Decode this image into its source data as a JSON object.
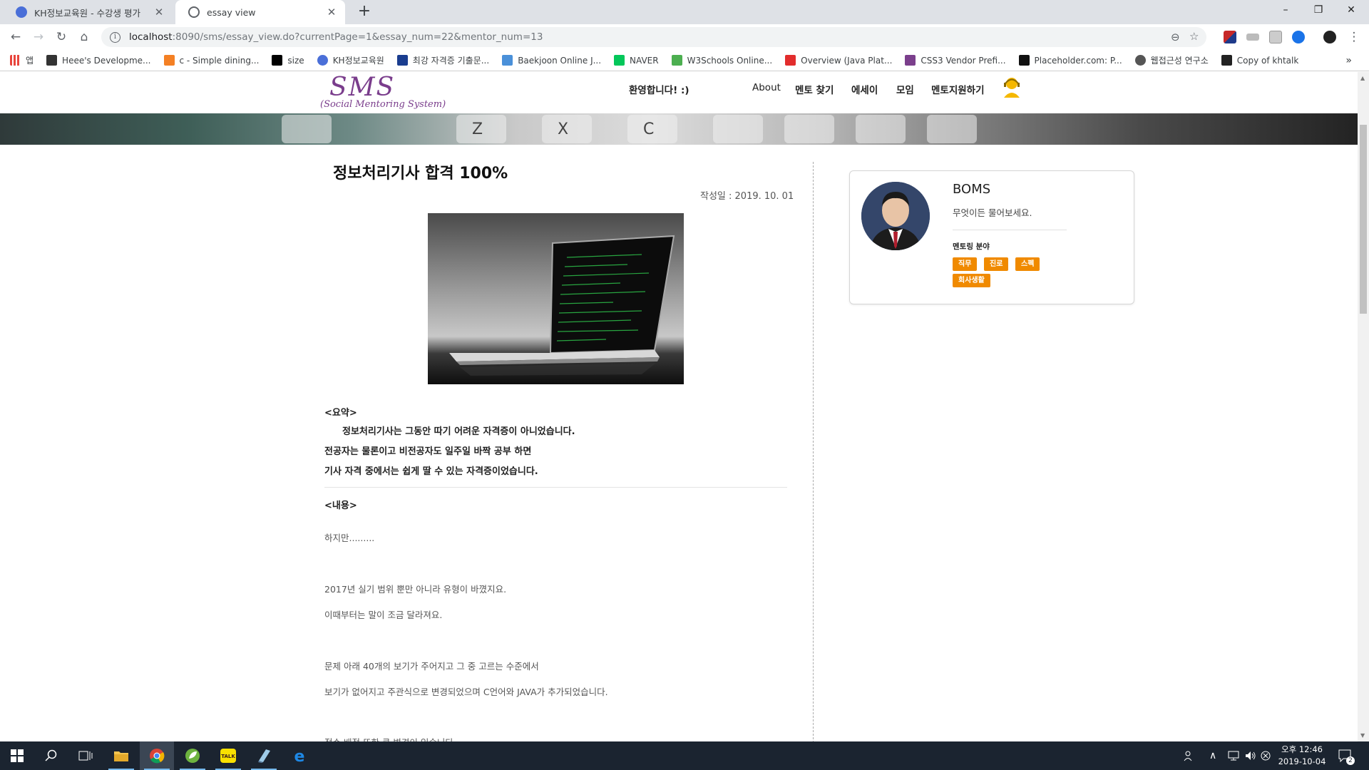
{
  "browser": {
    "tabs": [
      {
        "title": "KH정보교육원 - 수강생 평가",
        "favicon_color": "#4a6fd8"
      },
      {
        "title": "essay view",
        "favicon_color": "#5f6368"
      }
    ],
    "url_host": "localhost",
    "url_path": ":8090/sms/essay_view.do?currentPage=1&essay_num=22&mentor_num=13",
    "bookmarks": [
      {
        "label": "앱",
        "color": "#e8453c"
      },
      {
        "label": "Heee's Developme...",
        "color": "#333333"
      },
      {
        "label": "c - Simple dining...",
        "color": "#f48024"
      },
      {
        "label": "size",
        "color": "#000000"
      },
      {
        "label": "KH정보교육원",
        "color": "#4a6fd8"
      },
      {
        "label": "최강 자격증 기출문...",
        "color": "#1a3d8f"
      },
      {
        "label": "Baekjoon Online J...",
        "color": "#4a90d9"
      },
      {
        "label": "NAVER",
        "color": "#03c75a"
      },
      {
        "label": "W3Schools Online...",
        "color": "#4caf50"
      },
      {
        "label": "Overview (Java Plat...",
        "color": "#e22d2d"
      },
      {
        "label": "CSS3 Vendor Prefi...",
        "color": "#7b3f8c"
      },
      {
        "label": "Placeholder.com: P...",
        "color": "#111111"
      },
      {
        "label": "웹접근성 연구소",
        "color": "#555555"
      },
      {
        "label": "Copy of khtalk",
        "color": "#222222"
      }
    ]
  },
  "site": {
    "logo": "SMS",
    "logo_sub": "(Social Mentoring System)",
    "welcome": "환영합니다! :)",
    "nav": [
      "About",
      "멘토 찾기",
      "에세이",
      "모임",
      "멘토지원하기"
    ]
  },
  "article": {
    "title": "정보처리기사 합격 100%",
    "date": "작성일 : 2019. 10. 01",
    "summary_heading": "<요약>",
    "summary": [
      "정보처리기사는 그동안 따기 어려운 자격증이 아니었습니다.",
      "전공자는 물론이고 비전공자도 일주일 바짝 공부 하면",
      "기사 자격 중에서는 쉽게 딸 수 있는 자격증이었습니다."
    ],
    "content_heading": "<내용>",
    "content": [
      "하지만.........",
      "2017년 실기 범위 뿐만 아니라 유형이 바꼈지요.",
      "이때부터는 말이 조금 달라져요.",
      "문제 아래 40개의 보기가 주어지고 그 중 고르는 수준에서",
      "보기가 없어지고 주관식으로 변경되었으며 C언어와 JAVA가 추가되었습니다.",
      "점수 배점 또한 큰 변경이 있습니다."
    ]
  },
  "mentor": {
    "name": "BOMS",
    "message": "무엇이든 물어보세요.",
    "field_label": "멘토링 분야",
    "tags": [
      "직무",
      "진로",
      "스펙",
      "회사생활"
    ],
    "tag_color": "#f08a00"
  },
  "taskbar": {
    "time": "오후 12:46",
    "date": "2019-10-04",
    "notification_count": "2"
  }
}
